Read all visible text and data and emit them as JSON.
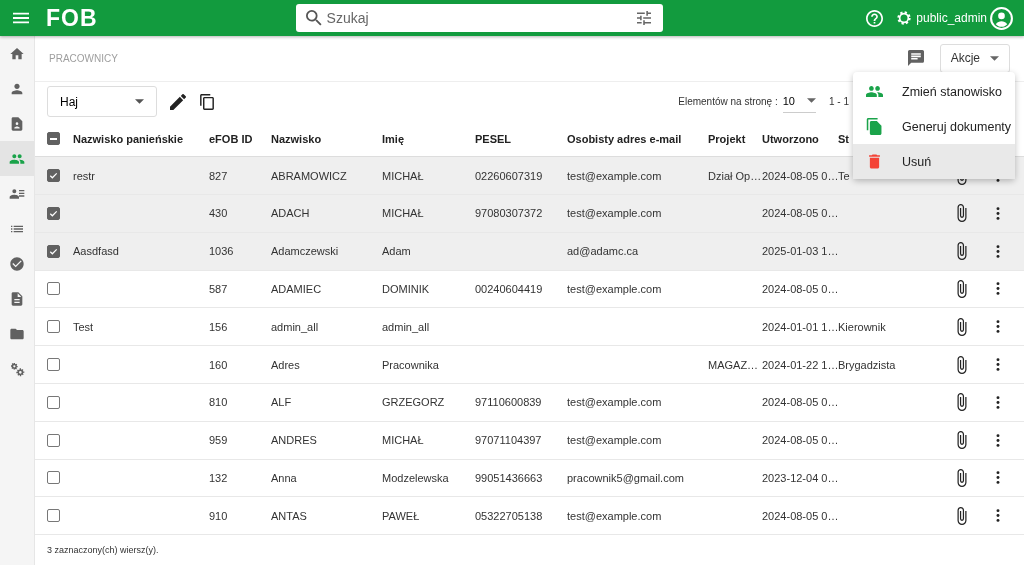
{
  "app_bar": {
    "logo": "FOB",
    "search": {
      "placeholder": "Szukaj"
    },
    "user": "public_admin"
  },
  "sidebar": {
    "items": [
      {
        "selected": false
      },
      {
        "selected": false
      },
      {
        "selected": false
      },
      {
        "selected": true
      },
      {
        "selected": false
      },
      {
        "selected": false
      },
      {
        "selected": false
      },
      {
        "selected": false
      },
      {
        "selected": false
      },
      {
        "selected": false
      }
    ]
  },
  "page": {
    "title": "PRACOWNICY",
    "actions_button": "Akcje"
  },
  "toolbar": {
    "view_select": "Haj",
    "per_page_label": "Elementów na stronę :",
    "per_page": "10",
    "range": "1 - 1"
  },
  "table": {
    "header_indeterminate": true,
    "columns": [
      "Nazwisko panieńskie",
      "eFOB ID",
      "Nazwisko",
      "Imię",
      "PESEL",
      "Osobisty adres e-mail",
      "Projekt",
      "Utworzono",
      "St"
    ],
    "rows": [
      {
        "checked": true,
        "cells": [
          "restr",
          "827",
          "ABRAMOWICZ",
          "MICHAŁ",
          "02260607319",
          "test@example.com",
          "Dział Op…",
          "2024-08-05 0…",
          "Te"
        ]
      },
      {
        "checked": true,
        "cells": [
          "",
          "430",
          "ADACH",
          "MICHAŁ",
          "97080307372",
          "test@example.com",
          "",
          "2024-08-05 0…",
          ""
        ]
      },
      {
        "checked": true,
        "cells": [
          "Aasdfasd",
          "1036",
          "Adamczewski",
          "Adam",
          "",
          "ad@adamc.ca",
          "",
          "2025-01-03 1…",
          ""
        ]
      },
      {
        "checked": false,
        "cells": [
          "",
          "587",
          "ADAMIEC",
          "DOMINIK",
          "00240604419",
          "test@example.com",
          "",
          "2024-08-05 0…",
          ""
        ]
      },
      {
        "checked": false,
        "cells": [
          "Test",
          "156",
          "admin_all",
          "admin_all",
          "",
          "",
          "",
          "2024-01-01 1…",
          "Kierownik"
        ]
      },
      {
        "checked": false,
        "cells": [
          "",
          "160",
          "Adres",
          "Pracownika",
          "",
          "",
          "MAGAZ…",
          "2024-01-22 1…",
          "Brygadzista"
        ]
      },
      {
        "checked": false,
        "cells": [
          "",
          "810",
          "ALF",
          "GRZEGORZ",
          "97110600839",
          "test@example.com",
          "",
          "2024-08-05 0…",
          ""
        ]
      },
      {
        "checked": false,
        "cells": [
          "",
          "959",
          "ANDRES",
          "MICHAŁ",
          "97071104397",
          "test@example.com",
          "",
          "2024-08-05 0…",
          ""
        ]
      },
      {
        "checked": false,
        "cells": [
          "",
          "132",
          "Anna",
          "Modzelewska",
          "99051436663",
          "pracownik5@gmail.com",
          "",
          "2023-12-04 0…",
          ""
        ]
      },
      {
        "checked": false,
        "cells": [
          "",
          "910",
          "ANTAS",
          "PAWEŁ",
          "05322705138",
          "test@example.com",
          "",
          "2024-08-05 0…",
          ""
        ]
      }
    ],
    "footer": "3 zaznaczony(ch) wiersz(y)."
  },
  "actions_menu": {
    "items": [
      {
        "label": "Zmień stanowisko",
        "highlighted": false
      },
      {
        "label": "Generuj dokumenty",
        "highlighted": false
      },
      {
        "label": "Usuń",
        "highlighted": true
      }
    ]
  }
}
